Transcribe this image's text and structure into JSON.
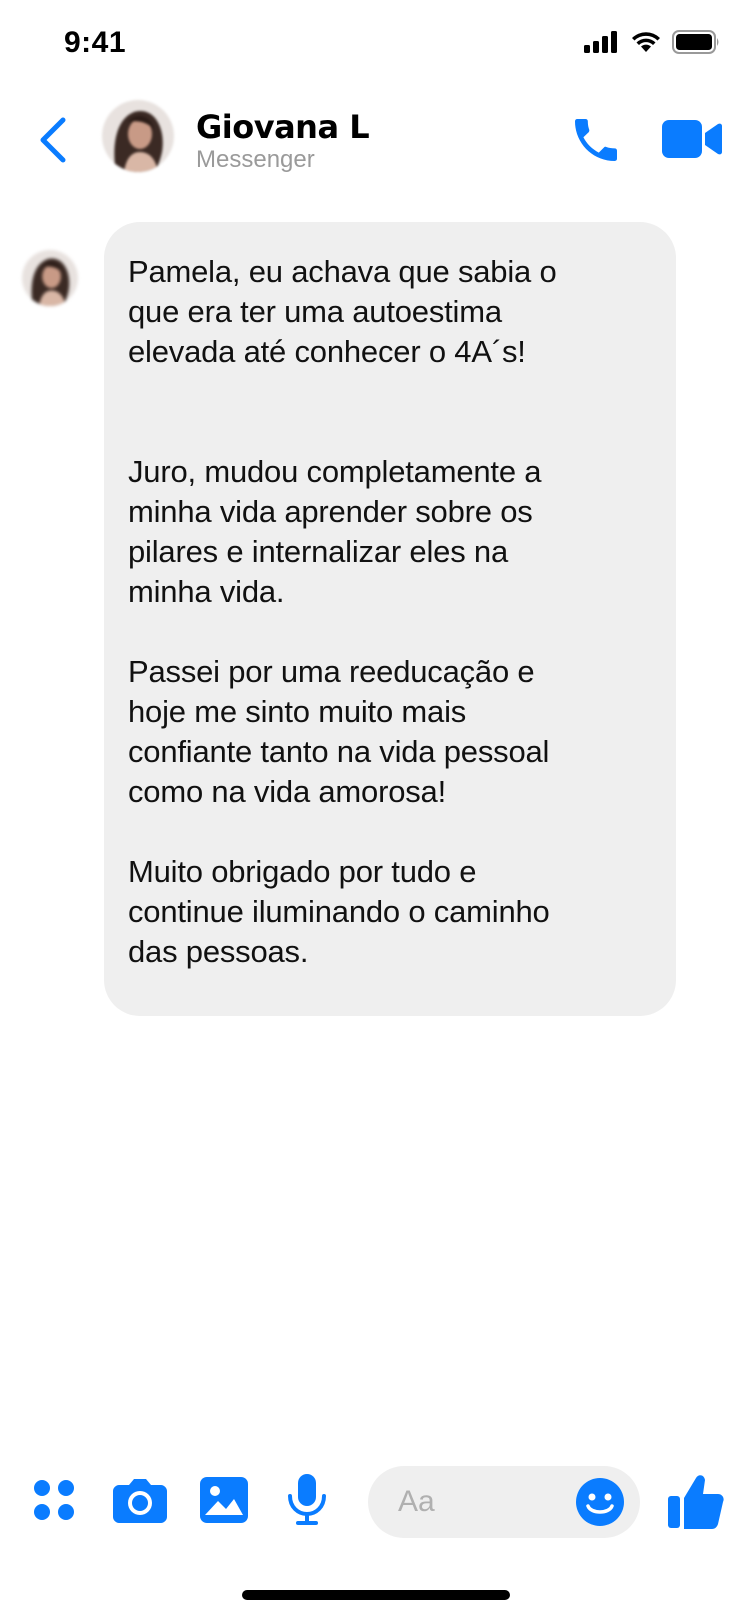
{
  "status_bar": {
    "time": "9:41"
  },
  "header": {
    "contact_name": "Giovana L",
    "subtitle": "Messenger"
  },
  "message": {
    "paragraphs": [
      "Pamela, eu achava que sabia o\nque era ter uma autoestima\nelevada até conhecer o 4A´s!",
      "Juro, mudou completamente a\nminha vida aprender sobre os\npilares e internalizar eles na\nminha vida.",
      "Passei por uma reeducação e\nhoje me sinto muito mais\nconfiante tanto na vida pessoal\ncomo na vida amorosa!",
      "Muito obrigado por tudo e\ncontinue iluminando o caminho\ndas pessoas."
    ]
  },
  "composer": {
    "placeholder": "Aa"
  },
  "colors": {
    "accent": "#0a7cff",
    "bubble": "#efefef",
    "subtitle": "#9a9a9a"
  },
  "icons": [
    "back-chevron-icon",
    "phone-icon",
    "video-camera-icon",
    "apps-icon",
    "camera-icon",
    "image-icon",
    "microphone-icon",
    "emoji-icon",
    "thumbs-up-icon"
  ]
}
